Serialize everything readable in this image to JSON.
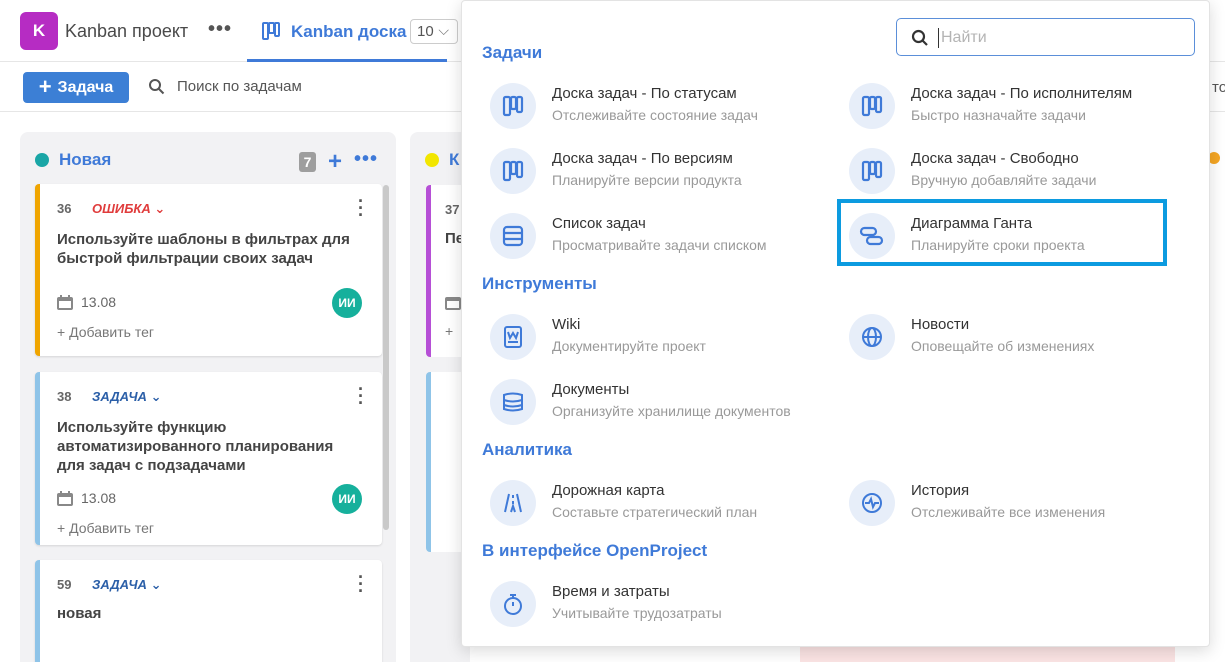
{
  "header": {
    "project_avatar": "K",
    "project_name": "Kanban проект",
    "tab_label": "Kanban доска",
    "tab_count": "10"
  },
  "toolbar": {
    "add_task_label": "Задача",
    "search_label": "Поиск по задачам",
    "right_cut_text": "то"
  },
  "columns": [
    {
      "name": "Новая",
      "color": "#1aa6a6",
      "count": "7",
      "cards": [
        {
          "id": "36",
          "type": "ОШИБКА",
          "type_color": "#e03c3c",
          "title": "Используйте шаблоны в фильтрах для быстрой фильтрации своих задач",
          "date": "13.08",
          "add_tag": "+ Добавить тег",
          "assignee": "ИИ",
          "border": "#f0a500"
        },
        {
          "id": "38",
          "type": "ЗАДАЧА",
          "type_color": "#2b5fa8",
          "title": "Используйте функцию автоматизированного планирования для задач с подзадачами",
          "date": "13.08",
          "add_tag": "+ Добавить тег",
          "assignee": "ИИ",
          "border": "#8fc4e8"
        },
        {
          "id": "59",
          "type": "ЗАДАЧА",
          "type_color": "#2b5fa8",
          "title": "новая",
          "border": "#8fc4e8"
        }
      ]
    },
    {
      "name": "К",
      "color": "#f2e600",
      "cards": [
        {
          "id": "37",
          "title": "Пе",
          "add_tag": "+"
        }
      ]
    }
  ],
  "dropdown": {
    "search_placeholder": "Найти",
    "sections": [
      {
        "title": "Задачи",
        "items": [
          {
            "name": "Доска задач - По статусам",
            "desc": "Отслеживайте состояние задач",
            "icon": "board-icon"
          },
          {
            "name": "Доска задач - По исполнителям",
            "desc": "Быстро назначайте задачи",
            "icon": "board-icon"
          },
          {
            "name": "Доска задач - По версиям",
            "desc": "Планируйте версии продукта",
            "icon": "board-icon"
          },
          {
            "name": "Доска задач - Свободно",
            "desc": "Вручную добавляйте задачи",
            "icon": "board-icon"
          },
          {
            "name": "Список задач",
            "desc": "Просматривайте задачи списком",
            "icon": "list-icon"
          },
          {
            "name": "Диаграмма Ганта",
            "desc": "Планируйте сроки проекта",
            "icon": "gantt-icon"
          }
        ]
      },
      {
        "title": "Инструменты",
        "items": [
          {
            "name": "Wiki",
            "desc": "Документируйте проект",
            "icon": "wiki-icon"
          },
          {
            "name": "Новости",
            "desc": "Оповещайте об изменениях",
            "icon": "globe-icon"
          },
          {
            "name": "Документы",
            "desc": "Организуйте хранилище документов",
            "icon": "documents-icon"
          }
        ]
      },
      {
        "title": "Аналитика",
        "items": [
          {
            "name": "Дорожная карта",
            "desc": "Составьте стратегический план",
            "icon": "roadmap-icon"
          },
          {
            "name": "История",
            "desc": "Отслеживайте все изменения",
            "icon": "activity-icon"
          }
        ]
      },
      {
        "title": "В интерфейсе OpenProject",
        "items": [
          {
            "name": "Время и затраты",
            "desc": "Учитывайте трудозатраты",
            "icon": "stopwatch-icon"
          }
        ]
      }
    ]
  },
  "colors": {
    "accent": "#3f7ad8",
    "highlight": "#0c9be0",
    "icon_bg": "#e7eef9"
  }
}
